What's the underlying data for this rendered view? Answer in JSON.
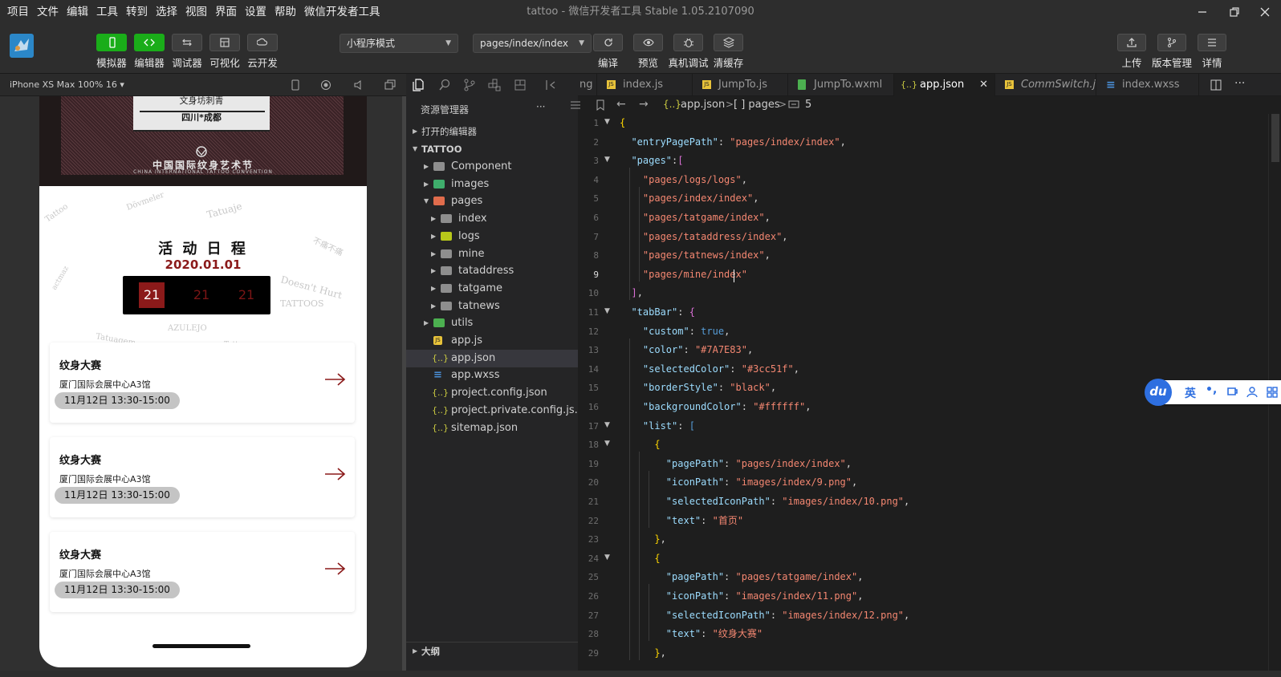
{
  "window": {
    "title": "tattoo - 微信开发者工具 Stable 1.05.2107090"
  },
  "menu": [
    "项目",
    "文件",
    "编辑",
    "工具",
    "转到",
    "选择",
    "视图",
    "界面",
    "设置",
    "帮助",
    "微信开发者工具"
  ],
  "toolbar": {
    "left": [
      {
        "label": "模拟器",
        "icon": "phone-icon"
      },
      {
        "label": "编辑器",
        "icon": "code-icon"
      },
      {
        "label": "调试器",
        "icon": "debug-icon"
      },
      {
        "label": "可视化",
        "icon": "layout-icon"
      },
      {
        "label": "云开发",
        "icon": "cloud-icon"
      }
    ],
    "mode": "小程序模式",
    "page": "pages/index/index",
    "mid": [
      {
        "label": "编译",
        "icon": "refresh-icon"
      },
      {
        "label": "预览",
        "icon": "eye-icon"
      },
      {
        "label": "真机调试",
        "icon": "bug-icon"
      },
      {
        "label": "清缓存",
        "icon": "layers-icon"
      }
    ],
    "right": [
      {
        "label": "上传",
        "icon": "upload-icon"
      },
      {
        "label": "版本管理",
        "icon": "branch-icon"
      },
      {
        "label": "详情",
        "icon": "menu-icon"
      }
    ]
  },
  "simulator": {
    "device": "iPhone XS Max 100% 16 ▾",
    "banner": {
      "line1": "文身坊刺青",
      "line2": "四川*成都",
      "footer": "中国国际纹身艺术节",
      "footer_en": "CHINA INTERNATIONAL TATTOO CONVENTION"
    },
    "schedule": {
      "title": "活 动 日 程",
      "date": "2020.01.01",
      "days": [
        "21",
        "21",
        "21"
      ]
    },
    "events": [
      {
        "title": "纹身大赛",
        "place": "厦门国际会展中心A3馆",
        "time": "11月12日 13:30-15:00"
      },
      {
        "title": "纹身大赛",
        "place": "厦门国际会展中心A3馆",
        "time": "11月12日 13:30-15:00"
      },
      {
        "title": "纹身大赛",
        "place": "厦门国际会展中心A3馆",
        "time": "11月12日 13:30-15:00"
      }
    ]
  },
  "explorer": {
    "title": "资源管理器",
    "more": "···",
    "open_editors": "打开的编辑器",
    "project": "TATTOO",
    "outline": "大纲",
    "items": [
      {
        "name": "Component",
        "type": "folder",
        "indent": 1,
        "arrow": "▶"
      },
      {
        "name": "images",
        "type": "folder-img",
        "indent": 1,
        "arrow": "▶"
      },
      {
        "name": "pages",
        "type": "folder-pages",
        "indent": 1,
        "arrow": "▼"
      },
      {
        "name": "index",
        "type": "folder",
        "indent": 2,
        "arrow": "▶"
      },
      {
        "name": "logs",
        "type": "folder-logs",
        "indent": 2,
        "arrow": "▶"
      },
      {
        "name": "mine",
        "type": "folder",
        "indent": 2,
        "arrow": "▶"
      },
      {
        "name": "tataddress",
        "type": "folder",
        "indent": 2,
        "arrow": "▶"
      },
      {
        "name": "tatgame",
        "type": "folder",
        "indent": 2,
        "arrow": "▶"
      },
      {
        "name": "tatnews",
        "type": "folder",
        "indent": 2,
        "arrow": "▶"
      },
      {
        "name": "utils",
        "type": "folder-utils",
        "indent": 1,
        "arrow": "▶"
      },
      {
        "name": "app.js",
        "type": "js",
        "indent": 1,
        "arrow": ""
      },
      {
        "name": "app.json",
        "type": "json",
        "indent": 1,
        "arrow": ""
      },
      {
        "name": "app.wxss",
        "type": "wxss",
        "indent": 1,
        "arrow": ""
      },
      {
        "name": "project.config.json",
        "type": "json",
        "indent": 1,
        "arrow": ""
      },
      {
        "name": "project.private.config.js...",
        "type": "json",
        "indent": 1,
        "arrow": ""
      },
      {
        "name": "sitemap.json",
        "type": "json",
        "indent": 1,
        "arrow": ""
      }
    ]
  },
  "tabs": [
    {
      "label": "ng",
      "type": "none"
    },
    {
      "label": "index.js",
      "type": "js"
    },
    {
      "label": "JumpTo.js",
      "type": "js"
    },
    {
      "label": "JumpTo.wxml",
      "type": "wxml"
    },
    {
      "label": "app.json",
      "type": "json",
      "active": true
    },
    {
      "label": "CommSwitch.js",
      "type": "js",
      "italic": true
    },
    {
      "label": "index.wxss",
      "type": "wxss"
    }
  ],
  "breadcrumb": {
    "file": "app.json",
    "sep": ">",
    "p1": "[ ] pages",
    "p2": "5"
  },
  "code": [
    {
      "n": "1",
      "t": [
        [
          "b",
          "{"
        ]
      ]
    },
    {
      "n": "2",
      "t": [
        [
          "",
          "  "
        ],
        [
          "k",
          "\"entryPagePath\""
        ],
        [
          "",
          ": "
        ],
        [
          "s",
          "\"pages/index/index\""
        ],
        [
          "",
          ","
        ]
      ]
    },
    {
      "n": "3",
      "t": [
        [
          "",
          "  "
        ],
        [
          "k",
          "\"pages\""
        ],
        [
          "",
          ":"
        ],
        [
          "b2",
          "["
        ]
      ]
    },
    {
      "n": "4",
      "t": [
        [
          "",
          "    "
        ],
        [
          "s",
          "\"pages/logs/logs\""
        ],
        [
          "",
          ","
        ]
      ]
    },
    {
      "n": "5",
      "t": [
        [
          "",
          "    "
        ],
        [
          "s",
          "\"pages/index/index\""
        ],
        [
          "",
          ","
        ]
      ]
    },
    {
      "n": "6",
      "t": [
        [
          "",
          "    "
        ],
        [
          "s",
          "\"pages/tatgame/index\""
        ],
        [
          "",
          ","
        ]
      ]
    },
    {
      "n": "7",
      "t": [
        [
          "",
          "    "
        ],
        [
          "s",
          "\"pages/tataddress/index\""
        ],
        [
          "",
          ","
        ]
      ]
    },
    {
      "n": "8",
      "t": [
        [
          "",
          "    "
        ],
        [
          "s",
          "\"pages/tatnews/index\""
        ],
        [
          "",
          ","
        ]
      ]
    },
    {
      "n": "9",
      "t": [
        [
          "",
          "    "
        ],
        [
          "s",
          "\"pages/mine/index\""
        ]
      ]
    },
    {
      "n": "10",
      "t": [
        [
          "",
          "  "
        ],
        [
          "b2",
          "]"
        ],
        [
          "",
          ","
        ]
      ]
    },
    {
      "n": "11",
      "t": [
        [
          "",
          "  "
        ],
        [
          "k",
          "\"tabBar\""
        ],
        [
          "",
          ": "
        ],
        [
          "b2",
          "{"
        ]
      ]
    },
    {
      "n": "12",
      "t": [
        [
          "",
          "    "
        ],
        [
          "k",
          "\"custom\""
        ],
        [
          "",
          ": "
        ],
        [
          "kw",
          "true"
        ],
        [
          "",
          ","
        ]
      ]
    },
    {
      "n": "13",
      "t": [
        [
          "",
          "    "
        ],
        [
          "k",
          "\"color\""
        ],
        [
          "",
          ": "
        ],
        [
          "s",
          "\"#7A7E83\""
        ],
        [
          "",
          ","
        ]
      ]
    },
    {
      "n": "14",
      "t": [
        [
          "",
          "    "
        ],
        [
          "k",
          "\"selectedColor\""
        ],
        [
          "",
          ": "
        ],
        [
          "s",
          "\"#3cc51f\""
        ],
        [
          "",
          ","
        ]
      ]
    },
    {
      "n": "15",
      "t": [
        [
          "",
          "    "
        ],
        [
          "k",
          "\"borderStyle\""
        ],
        [
          "",
          ": "
        ],
        [
          "s",
          "\"black\""
        ],
        [
          "",
          ","
        ]
      ]
    },
    {
      "n": "16",
      "t": [
        [
          "",
          "    "
        ],
        [
          "k",
          "\"backgroundColor\""
        ],
        [
          "",
          ": "
        ],
        [
          "s",
          "\"#ffffff\""
        ],
        [
          "",
          ","
        ]
      ]
    },
    {
      "n": "17",
      "t": [
        [
          "",
          "    "
        ],
        [
          "k",
          "\"list\""
        ],
        [
          "",
          ": "
        ],
        [
          "kw",
          "["
        ]
      ]
    },
    {
      "n": "18",
      "t": [
        [
          "",
          "      "
        ],
        [
          "b",
          "{"
        ]
      ]
    },
    {
      "n": "19",
      "t": [
        [
          "",
          "        "
        ],
        [
          "k",
          "\"pagePath\""
        ],
        [
          "",
          ": "
        ],
        [
          "s",
          "\"pages/index/index\""
        ],
        [
          "",
          ","
        ]
      ]
    },
    {
      "n": "20",
      "t": [
        [
          "",
          "        "
        ],
        [
          "k",
          "\"iconPath\""
        ],
        [
          "",
          ": "
        ],
        [
          "s",
          "\"images/index/9.png\""
        ],
        [
          "",
          ","
        ]
      ]
    },
    {
      "n": "21",
      "t": [
        [
          "",
          "        "
        ],
        [
          "k",
          "\"selectedIconPath\""
        ],
        [
          "",
          ": "
        ],
        [
          "s",
          "\"images/index/10.png\""
        ],
        [
          "",
          ","
        ]
      ]
    },
    {
      "n": "22",
      "t": [
        [
          "",
          "        "
        ],
        [
          "k",
          "\"text\""
        ],
        [
          "",
          ": "
        ],
        [
          "s",
          "\"首页\""
        ]
      ]
    },
    {
      "n": "23",
      "t": [
        [
          "",
          "      "
        ],
        [
          "b",
          "}"
        ],
        [
          "",
          ","
        ]
      ]
    },
    {
      "n": "24",
      "t": [
        [
          "",
          "      "
        ],
        [
          "b",
          "{"
        ]
      ]
    },
    {
      "n": "25",
      "t": [
        [
          "",
          "        "
        ],
        [
          "k",
          "\"pagePath\""
        ],
        [
          "",
          ": "
        ],
        [
          "s",
          "\"pages/tatgame/index\""
        ],
        [
          "",
          ","
        ]
      ]
    },
    {
      "n": "26",
      "t": [
        [
          "",
          "        "
        ],
        [
          "k",
          "\"iconPath\""
        ],
        [
          "",
          ": "
        ],
        [
          "s",
          "\"images/index/11.png\""
        ],
        [
          "",
          ","
        ]
      ]
    },
    {
      "n": "27",
      "t": [
        [
          "",
          "        "
        ],
        [
          "k",
          "\"selectedIconPath\""
        ],
        [
          "",
          ": "
        ],
        [
          "s",
          "\"images/index/12.png\""
        ],
        [
          "",
          ","
        ]
      ]
    },
    {
      "n": "28",
      "t": [
        [
          "",
          "        "
        ],
        [
          "k",
          "\"text\""
        ],
        [
          "",
          ": "
        ],
        [
          "s",
          "\"纹身大赛\""
        ]
      ]
    },
    {
      "n": "29",
      "t": [
        [
          "",
          "      "
        ],
        [
          "b",
          "}"
        ],
        [
          "",
          ","
        ]
      ]
    }
  ],
  "ime": {
    "logo": "du",
    "lang": "英",
    "punct": "•,"
  },
  "colors": {
    "accent_green": "#1aad19",
    "schedule_red": "#8b1a1a",
    "editor_bg": "#1e1e1e"
  }
}
